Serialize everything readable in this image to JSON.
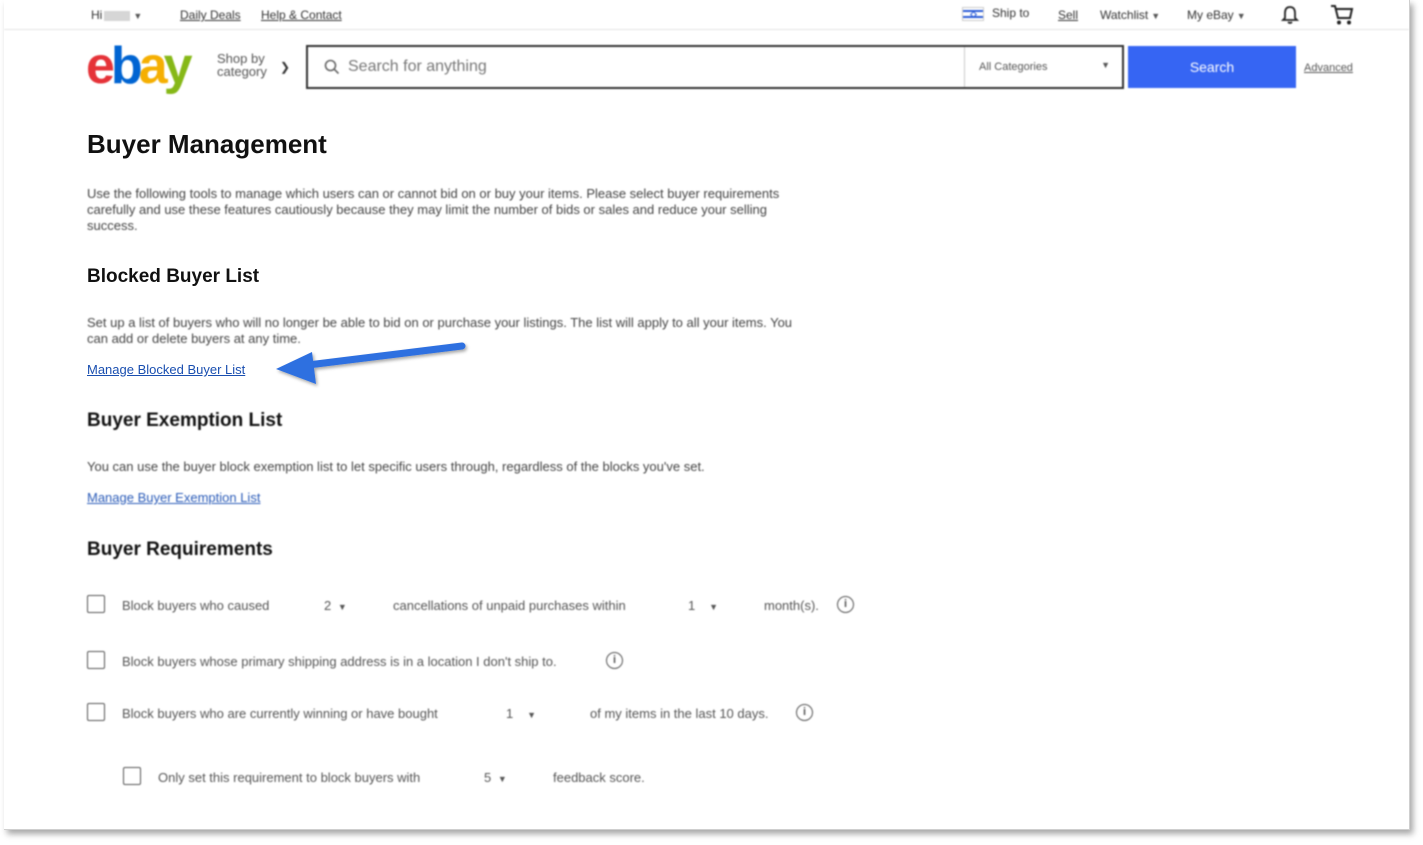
{
  "topnav": {
    "greeting": "Hi",
    "daily_deals": "Daily Deals",
    "help_contact": "Help & Contact",
    "ship_to": "Ship to",
    "sell": "Sell",
    "watchlist": "Watchlist",
    "my_ebay": "My eBay"
  },
  "header": {
    "logo": {
      "e": "e",
      "b": "b",
      "a": "a",
      "y": "y"
    },
    "shop_by_line1": "Shop by",
    "shop_by_line2": "category",
    "search_placeholder": "Search for anything",
    "category_select": "All Categories",
    "search_button": "Search",
    "advanced": "Advanced"
  },
  "page": {
    "title": "Buyer Management",
    "intro": "Use the following tools to manage which users can or cannot bid on or buy your items. Please select buyer requirements carefully and use these features cautiously because they may limit the number of bids or sales and reduce your selling success.",
    "blocked": {
      "heading": "Blocked Buyer List",
      "desc": "Set up a list of buyers who will no longer be able to bid on or purchase your listings. The list will apply to all your items. You can add or delete buyers at any time.",
      "link": "Manage Blocked Buyer List"
    },
    "exemption": {
      "heading": "Buyer Exemption List",
      "desc": "You can use the buyer block exemption list to let specific users through, regardless of the blocks you've set.",
      "link": "Manage Buyer Exemption List"
    },
    "requirements": {
      "heading": "Buyer Requirements",
      "row1": {
        "a": "Block buyers who caused",
        "count": "2",
        "b": "cancellations of unpaid purchases within",
        "months": "1",
        "c": "month(s)."
      },
      "row2": {
        "a": "Block buyers whose primary shipping address is in a location I don't ship to."
      },
      "row3": {
        "a": "Block buyers who are currently winning or have bought",
        "count": "1",
        "b": "of my items in the last 10 days."
      },
      "row4": {
        "a": "Only set this requirement to block buyers with",
        "score": "5",
        "b": "feedback score."
      }
    }
  },
  "colors": {
    "search_button": "#3665f3",
    "link": "#2a5bb8",
    "annotation_arrow": "#2f6fe0"
  }
}
